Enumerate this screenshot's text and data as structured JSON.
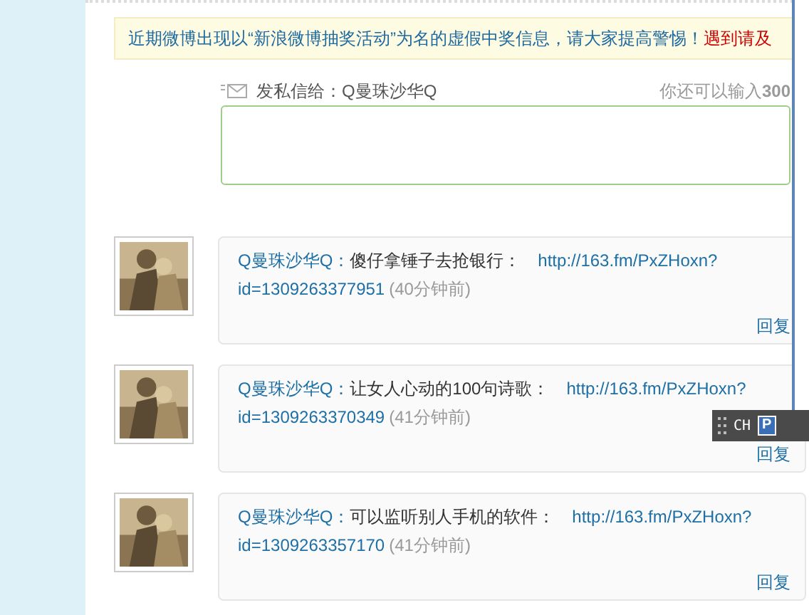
{
  "notice": {
    "text": "近期微博出现以“新浪微博抽奖活动”为名的虚假中奖信息，请大家提高警惕！",
    "warning": "遇到请及"
  },
  "compose": {
    "label": "发私信给：Q曼珠沙华Q",
    "counter": "你还可以输入**300**"
  },
  "messages": [
    {
      "author": "Q曼珠沙华Q：",
      "text": "傻仔拿锤子去抢银行：",
      "link_lines": [
        "http://163.fm/PxZHoxn?",
        "id=1309263377951"
      ],
      "time": "(40分钟前)",
      "reply": "回复"
    },
    {
      "author": "Q曼珠沙华Q：",
      "text": "让女人心动的100句诗歌：",
      "link_lines": [
        "http://163.fm/PxZHoxn?",
        "id=1309263370349"
      ],
      "time": "(41分钟前)",
      "reply": "回复"
    },
    {
      "author": "Q曼珠沙华Q：",
      "text": "可以监听别人手机的软件：",
      "link_lines": [
        "http://163.fm/PxZHoxn?",
        "id=1309263357170"
      ],
      "time": "(41分钟前)",
      "reply": "回复"
    }
  ],
  "ime_bar": {
    "label": "CH",
    "icon_letter": "P"
  }
}
